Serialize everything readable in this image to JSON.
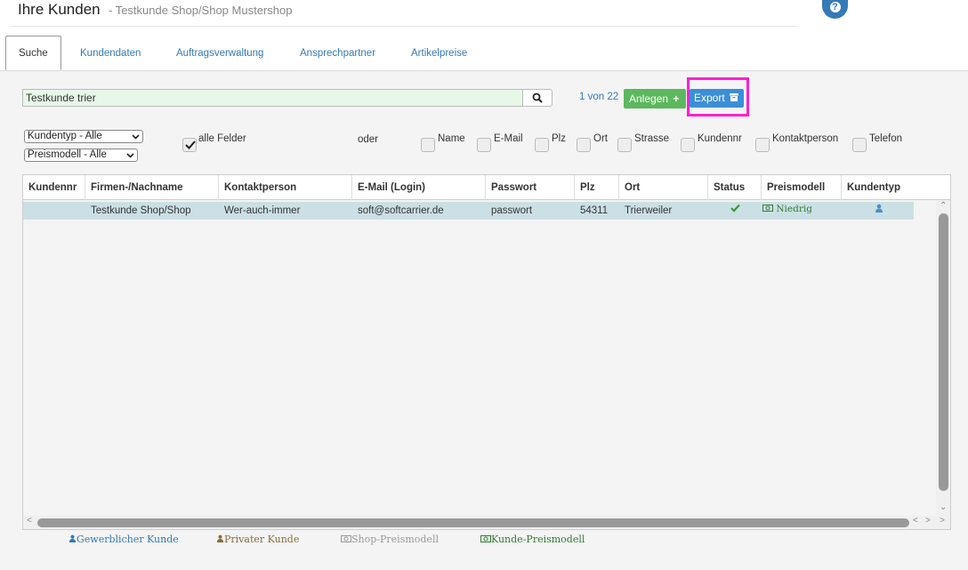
{
  "header": {
    "title": "Ihre Kunden",
    "subtitle": "- Testkunde Shop/Shop Mustershop",
    "help_label": "?"
  },
  "tabs": [
    {
      "label": "Suche",
      "active": true
    },
    {
      "label": "Kundendaten"
    },
    {
      "label": "Auftragsverwaltung"
    },
    {
      "label": "Ansprechpartner"
    },
    {
      "label": "Artikelpreise"
    }
  ],
  "search": {
    "value": "Testkunde trier",
    "icon": "search-icon"
  },
  "pager": {
    "text": "1 von 22"
  },
  "buttons": {
    "anlegen": "Anlegen",
    "export": "Export"
  },
  "filters": {
    "kundentyp": "Kundentyp - Alle",
    "preismodell": "Preismodell - Alle",
    "oder": "oder",
    "checkboxes": [
      {
        "label": "alle Felder",
        "checked": true
      },
      {
        "label": "Name",
        "checked": false
      },
      {
        "label": "E-Mail",
        "checked": false
      },
      {
        "label": "Plz",
        "checked": false
      },
      {
        "label": "Ort",
        "checked": false
      },
      {
        "label": "Strasse",
        "checked": false
      },
      {
        "label": "Kundennr",
        "checked": false
      },
      {
        "label": "Kontaktperson",
        "checked": false
      },
      {
        "label": "Telefon",
        "checked": false
      }
    ]
  },
  "table": {
    "columns": [
      "Kundennr",
      "Firmen-/Nachname",
      "Kontaktperson",
      "E-Mail (Login)",
      "Passwort",
      "Plz",
      "Ort",
      "Status",
      "Preismodell",
      "Kundentyp"
    ],
    "rows": [
      {
        "kundennr": "",
        "name": "Testkunde Shop/Shop",
        "kontakt": "Wer-auch-immer",
        "email": "soft@softcarrier.de",
        "passwort": "passwort",
        "plz": "54311",
        "ort": "Trierweiler",
        "status_icon": "check-icon",
        "preismodell": "Niedrig",
        "kundentyp_icon": "user-icon"
      }
    ]
  },
  "legend": {
    "gewerblich": "Gewerblicher Kunde",
    "privat": "Privater Kunde",
    "shop_preis": "Shop-Preismodell",
    "kunde_preis": "Kunde-Preismodell"
  },
  "colors": {
    "accent": "#337ab7",
    "success": "#5cb85c",
    "highlight": "#ff1fcf",
    "row_selected": "#cbe0e4",
    "privat": "#8b6b3a",
    "kunde_preis": "#2e7d32"
  }
}
